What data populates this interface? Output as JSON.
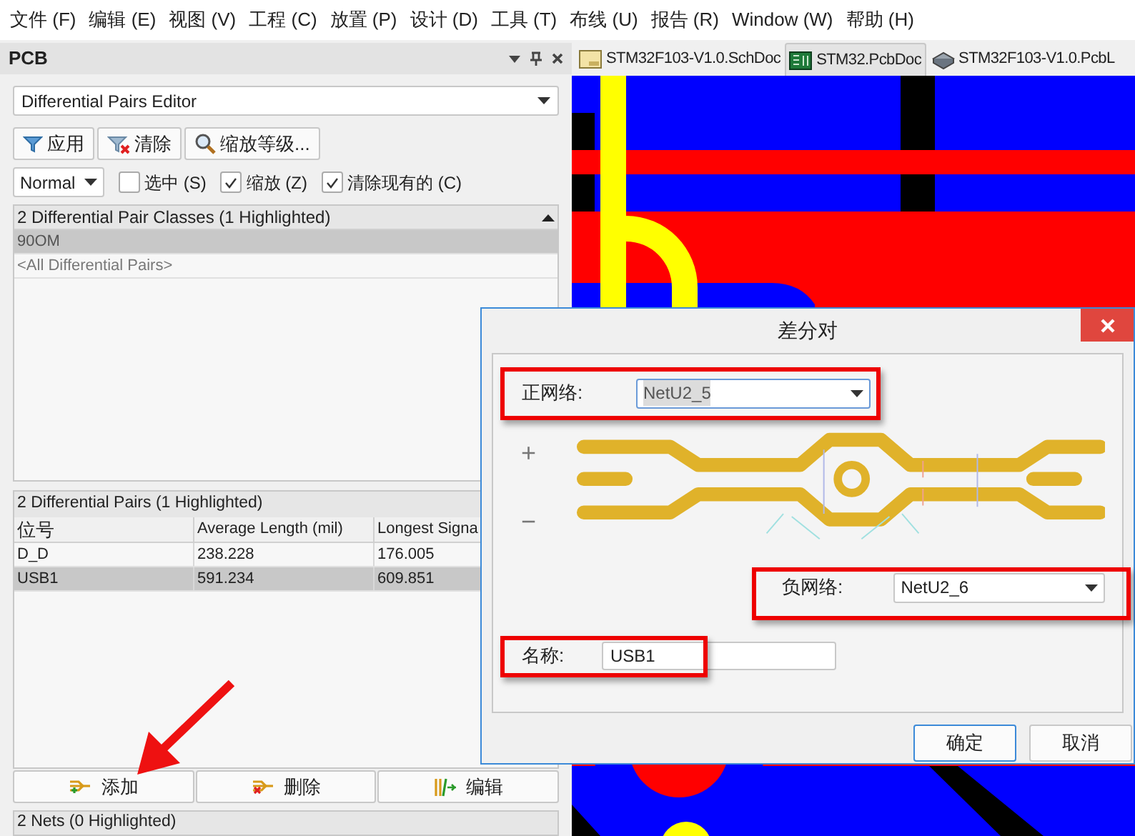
{
  "menu": [
    "文件 (F)",
    "编辑 (E)",
    "视图 (V)",
    "工程 (C)",
    "放置 (P)",
    "设计 (D)",
    "工具 (T)",
    "布线 (U)",
    "报告 (R)",
    "Window (W)",
    "帮助 (H)"
  ],
  "panel": {
    "title": "PCB",
    "mode": "Differential Pairs Editor",
    "actions": [
      {
        "kind": "apply",
        "label": "应用"
      },
      {
        "kind": "clear",
        "label": "清除"
      },
      {
        "kind": "zoom",
        "label": "缩放等级..."
      }
    ],
    "filter_mode": "Normal",
    "options": [
      {
        "label": "选中 (S)",
        "checked": false
      },
      {
        "label": "缩放 (Z)",
        "checked": true
      },
      {
        "label": "清除现有的 (C)",
        "checked": true
      }
    ],
    "classes": {
      "header": "2 Differential Pair Classes (1 Highlighted)",
      "rows": [
        {
          "label": "90OM",
          "selected": true
        },
        {
          "label": "<All Differential Pairs>",
          "selected": false
        }
      ]
    },
    "pairs": {
      "header": "2 Differential Pairs (1 Highlighted)",
      "columns": [
        "位号",
        "Average Length (mil)",
        "Longest Signa"
      ],
      "rows": [
        {
          "cells": [
            "D_D",
            "238.228",
            "176.005"
          ],
          "selected": false
        },
        {
          "cells": [
            "USB1",
            "591.234",
            "609.851"
          ],
          "selected": true
        }
      ]
    },
    "pair_buttons": [
      {
        "kind": "add",
        "label": "添加"
      },
      {
        "kind": "remove",
        "label": "删除"
      },
      {
        "kind": "edit",
        "label": "编辑"
      }
    ],
    "nets_header": "2 Nets (0 Highlighted)"
  },
  "tabs": [
    {
      "kind": "sch",
      "label": "STM32F103-V1.0.SchDoc",
      "selected": false
    },
    {
      "kind": "pcb",
      "label": "STM32.PcbDoc",
      "selected": true
    },
    {
      "kind": "lib",
      "label": "STM32F103-V1.0.PcbL",
      "selected": false
    }
  ],
  "dialog": {
    "title": "差分对",
    "positive_label": "正网络:",
    "positive_net": "NetU2_5",
    "plus": "+",
    "minus": "−",
    "negative_label": "负网络:",
    "negative_net": "NetU2_6",
    "name_label": "名称:",
    "name_value": "USB1",
    "buttons": [
      "确定",
      "取消"
    ]
  }
}
